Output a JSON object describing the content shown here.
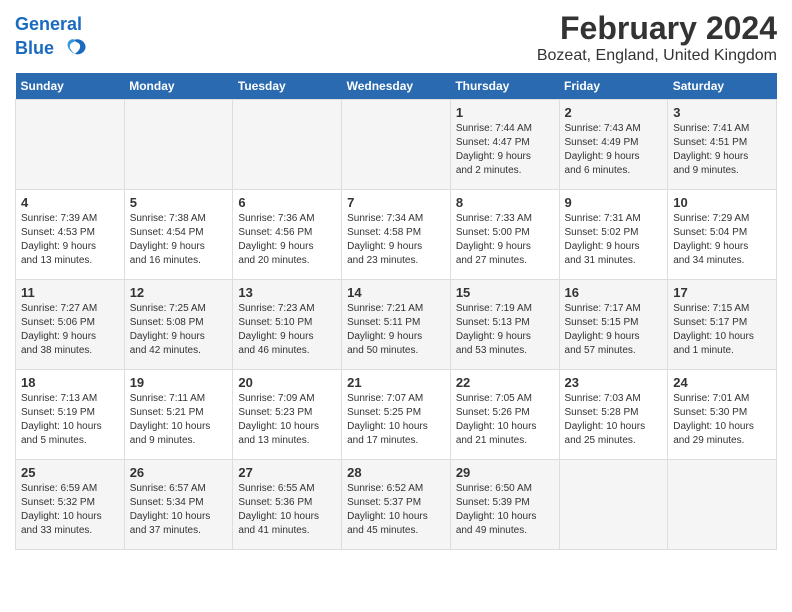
{
  "header": {
    "logo_line1": "General",
    "logo_line2": "Blue",
    "title": "February 2024",
    "subtitle": "Bozeat, England, United Kingdom"
  },
  "days_of_week": [
    "Sunday",
    "Monday",
    "Tuesday",
    "Wednesday",
    "Thursday",
    "Friday",
    "Saturday"
  ],
  "weeks": [
    [
      {
        "day": "",
        "info": ""
      },
      {
        "day": "",
        "info": ""
      },
      {
        "day": "",
        "info": ""
      },
      {
        "day": "",
        "info": ""
      },
      {
        "day": "1",
        "info": "Sunrise: 7:44 AM\nSunset: 4:47 PM\nDaylight: 9 hours\nand 2 minutes."
      },
      {
        "day": "2",
        "info": "Sunrise: 7:43 AM\nSunset: 4:49 PM\nDaylight: 9 hours\nand 6 minutes."
      },
      {
        "day": "3",
        "info": "Sunrise: 7:41 AM\nSunset: 4:51 PM\nDaylight: 9 hours\nand 9 minutes."
      }
    ],
    [
      {
        "day": "4",
        "info": "Sunrise: 7:39 AM\nSunset: 4:53 PM\nDaylight: 9 hours\nand 13 minutes."
      },
      {
        "day": "5",
        "info": "Sunrise: 7:38 AM\nSunset: 4:54 PM\nDaylight: 9 hours\nand 16 minutes."
      },
      {
        "day": "6",
        "info": "Sunrise: 7:36 AM\nSunset: 4:56 PM\nDaylight: 9 hours\nand 20 minutes."
      },
      {
        "day": "7",
        "info": "Sunrise: 7:34 AM\nSunset: 4:58 PM\nDaylight: 9 hours\nand 23 minutes."
      },
      {
        "day": "8",
        "info": "Sunrise: 7:33 AM\nSunset: 5:00 PM\nDaylight: 9 hours\nand 27 minutes."
      },
      {
        "day": "9",
        "info": "Sunrise: 7:31 AM\nSunset: 5:02 PM\nDaylight: 9 hours\nand 31 minutes."
      },
      {
        "day": "10",
        "info": "Sunrise: 7:29 AM\nSunset: 5:04 PM\nDaylight: 9 hours\nand 34 minutes."
      }
    ],
    [
      {
        "day": "11",
        "info": "Sunrise: 7:27 AM\nSunset: 5:06 PM\nDaylight: 9 hours\nand 38 minutes."
      },
      {
        "day": "12",
        "info": "Sunrise: 7:25 AM\nSunset: 5:08 PM\nDaylight: 9 hours\nand 42 minutes."
      },
      {
        "day": "13",
        "info": "Sunrise: 7:23 AM\nSunset: 5:10 PM\nDaylight: 9 hours\nand 46 minutes."
      },
      {
        "day": "14",
        "info": "Sunrise: 7:21 AM\nSunset: 5:11 PM\nDaylight: 9 hours\nand 50 minutes."
      },
      {
        "day": "15",
        "info": "Sunrise: 7:19 AM\nSunset: 5:13 PM\nDaylight: 9 hours\nand 53 minutes."
      },
      {
        "day": "16",
        "info": "Sunrise: 7:17 AM\nSunset: 5:15 PM\nDaylight: 9 hours\nand 57 minutes."
      },
      {
        "day": "17",
        "info": "Sunrise: 7:15 AM\nSunset: 5:17 PM\nDaylight: 10 hours\nand 1 minute."
      }
    ],
    [
      {
        "day": "18",
        "info": "Sunrise: 7:13 AM\nSunset: 5:19 PM\nDaylight: 10 hours\nand 5 minutes."
      },
      {
        "day": "19",
        "info": "Sunrise: 7:11 AM\nSunset: 5:21 PM\nDaylight: 10 hours\nand 9 minutes."
      },
      {
        "day": "20",
        "info": "Sunrise: 7:09 AM\nSunset: 5:23 PM\nDaylight: 10 hours\nand 13 minutes."
      },
      {
        "day": "21",
        "info": "Sunrise: 7:07 AM\nSunset: 5:25 PM\nDaylight: 10 hours\nand 17 minutes."
      },
      {
        "day": "22",
        "info": "Sunrise: 7:05 AM\nSunset: 5:26 PM\nDaylight: 10 hours\nand 21 minutes."
      },
      {
        "day": "23",
        "info": "Sunrise: 7:03 AM\nSunset: 5:28 PM\nDaylight: 10 hours\nand 25 minutes."
      },
      {
        "day": "24",
        "info": "Sunrise: 7:01 AM\nSunset: 5:30 PM\nDaylight: 10 hours\nand 29 minutes."
      }
    ],
    [
      {
        "day": "25",
        "info": "Sunrise: 6:59 AM\nSunset: 5:32 PM\nDaylight: 10 hours\nand 33 minutes."
      },
      {
        "day": "26",
        "info": "Sunrise: 6:57 AM\nSunset: 5:34 PM\nDaylight: 10 hours\nand 37 minutes."
      },
      {
        "day": "27",
        "info": "Sunrise: 6:55 AM\nSunset: 5:36 PM\nDaylight: 10 hours\nand 41 minutes."
      },
      {
        "day": "28",
        "info": "Sunrise: 6:52 AM\nSunset: 5:37 PM\nDaylight: 10 hours\nand 45 minutes."
      },
      {
        "day": "29",
        "info": "Sunrise: 6:50 AM\nSunset: 5:39 PM\nDaylight: 10 hours\nand 49 minutes."
      },
      {
        "day": "",
        "info": ""
      },
      {
        "day": "",
        "info": ""
      }
    ]
  ]
}
